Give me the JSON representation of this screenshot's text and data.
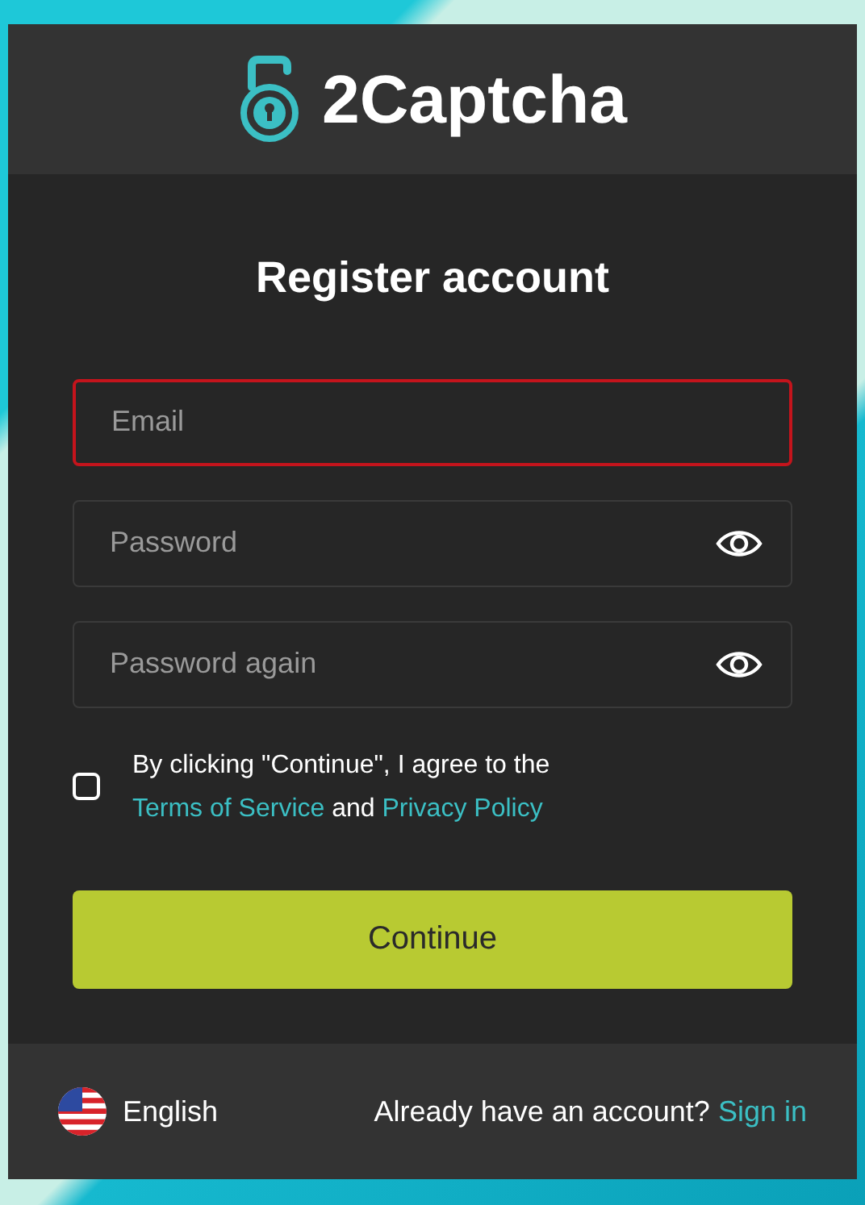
{
  "brand": {
    "name": "2Captcha"
  },
  "title": "Register account",
  "fields": [
    {
      "placeholder": "Email",
      "error": true,
      "kind": "text"
    },
    {
      "placeholder": "Password",
      "error": false,
      "kind": "password"
    },
    {
      "placeholder": "Password again",
      "error": false,
      "kind": "password"
    }
  ],
  "agreement": {
    "checked": false,
    "text": "By clicking \"Continue\", I agree to the",
    "terms_link": "Terms of Service",
    "joiner": "and",
    "privacy_link": "Privacy Policy"
  },
  "submit": "Continue",
  "footer": {
    "language": "English",
    "prompt": "Already have an account?",
    "sign_in": "Sign in"
  }
}
